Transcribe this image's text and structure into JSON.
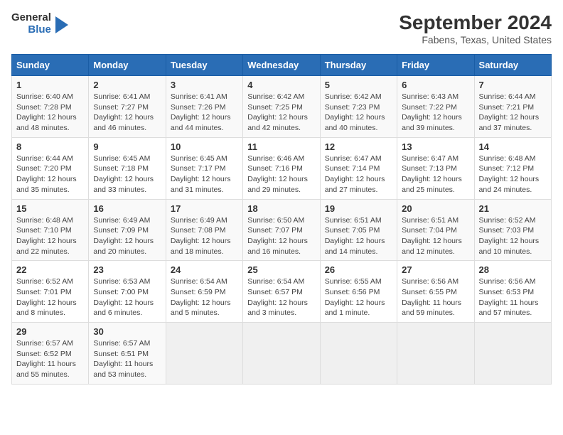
{
  "logo": {
    "line1": "General",
    "line2": "Blue"
  },
  "title": "September 2024",
  "subtitle": "Fabens, Texas, United States",
  "days_header": [
    "Sunday",
    "Monday",
    "Tuesday",
    "Wednesday",
    "Thursday",
    "Friday",
    "Saturday"
  ],
  "weeks": [
    [
      {
        "day": "1",
        "info": "Sunrise: 6:40 AM\nSunset: 7:28 PM\nDaylight: 12 hours\nand 48 minutes."
      },
      {
        "day": "2",
        "info": "Sunrise: 6:41 AM\nSunset: 7:27 PM\nDaylight: 12 hours\nand 46 minutes."
      },
      {
        "day": "3",
        "info": "Sunrise: 6:41 AM\nSunset: 7:26 PM\nDaylight: 12 hours\nand 44 minutes."
      },
      {
        "day": "4",
        "info": "Sunrise: 6:42 AM\nSunset: 7:25 PM\nDaylight: 12 hours\nand 42 minutes."
      },
      {
        "day": "5",
        "info": "Sunrise: 6:42 AM\nSunset: 7:23 PM\nDaylight: 12 hours\nand 40 minutes."
      },
      {
        "day": "6",
        "info": "Sunrise: 6:43 AM\nSunset: 7:22 PM\nDaylight: 12 hours\nand 39 minutes."
      },
      {
        "day": "7",
        "info": "Sunrise: 6:44 AM\nSunset: 7:21 PM\nDaylight: 12 hours\nand 37 minutes."
      }
    ],
    [
      {
        "day": "8",
        "info": "Sunrise: 6:44 AM\nSunset: 7:20 PM\nDaylight: 12 hours\nand 35 minutes."
      },
      {
        "day": "9",
        "info": "Sunrise: 6:45 AM\nSunset: 7:18 PM\nDaylight: 12 hours\nand 33 minutes."
      },
      {
        "day": "10",
        "info": "Sunrise: 6:45 AM\nSunset: 7:17 PM\nDaylight: 12 hours\nand 31 minutes."
      },
      {
        "day": "11",
        "info": "Sunrise: 6:46 AM\nSunset: 7:16 PM\nDaylight: 12 hours\nand 29 minutes."
      },
      {
        "day": "12",
        "info": "Sunrise: 6:47 AM\nSunset: 7:14 PM\nDaylight: 12 hours\nand 27 minutes."
      },
      {
        "day": "13",
        "info": "Sunrise: 6:47 AM\nSunset: 7:13 PM\nDaylight: 12 hours\nand 25 minutes."
      },
      {
        "day": "14",
        "info": "Sunrise: 6:48 AM\nSunset: 7:12 PM\nDaylight: 12 hours\nand 24 minutes."
      }
    ],
    [
      {
        "day": "15",
        "info": "Sunrise: 6:48 AM\nSunset: 7:10 PM\nDaylight: 12 hours\nand 22 minutes."
      },
      {
        "day": "16",
        "info": "Sunrise: 6:49 AM\nSunset: 7:09 PM\nDaylight: 12 hours\nand 20 minutes."
      },
      {
        "day": "17",
        "info": "Sunrise: 6:49 AM\nSunset: 7:08 PM\nDaylight: 12 hours\nand 18 minutes."
      },
      {
        "day": "18",
        "info": "Sunrise: 6:50 AM\nSunset: 7:07 PM\nDaylight: 12 hours\nand 16 minutes."
      },
      {
        "day": "19",
        "info": "Sunrise: 6:51 AM\nSunset: 7:05 PM\nDaylight: 12 hours\nand 14 minutes."
      },
      {
        "day": "20",
        "info": "Sunrise: 6:51 AM\nSunset: 7:04 PM\nDaylight: 12 hours\nand 12 minutes."
      },
      {
        "day": "21",
        "info": "Sunrise: 6:52 AM\nSunset: 7:03 PM\nDaylight: 12 hours\nand 10 minutes."
      }
    ],
    [
      {
        "day": "22",
        "info": "Sunrise: 6:52 AM\nSunset: 7:01 PM\nDaylight: 12 hours\nand 8 minutes."
      },
      {
        "day": "23",
        "info": "Sunrise: 6:53 AM\nSunset: 7:00 PM\nDaylight: 12 hours\nand 6 minutes."
      },
      {
        "day": "24",
        "info": "Sunrise: 6:54 AM\nSunset: 6:59 PM\nDaylight: 12 hours\nand 5 minutes."
      },
      {
        "day": "25",
        "info": "Sunrise: 6:54 AM\nSunset: 6:57 PM\nDaylight: 12 hours\nand 3 minutes."
      },
      {
        "day": "26",
        "info": "Sunrise: 6:55 AM\nSunset: 6:56 PM\nDaylight: 12 hours\nand 1 minute."
      },
      {
        "day": "27",
        "info": "Sunrise: 6:56 AM\nSunset: 6:55 PM\nDaylight: 11 hours\nand 59 minutes."
      },
      {
        "day": "28",
        "info": "Sunrise: 6:56 AM\nSunset: 6:53 PM\nDaylight: 11 hours\nand 57 minutes."
      }
    ],
    [
      {
        "day": "29",
        "info": "Sunrise: 6:57 AM\nSunset: 6:52 PM\nDaylight: 11 hours\nand 55 minutes."
      },
      {
        "day": "30",
        "info": "Sunrise: 6:57 AM\nSunset: 6:51 PM\nDaylight: 11 hours\nand 53 minutes."
      },
      null,
      null,
      null,
      null,
      null
    ]
  ]
}
